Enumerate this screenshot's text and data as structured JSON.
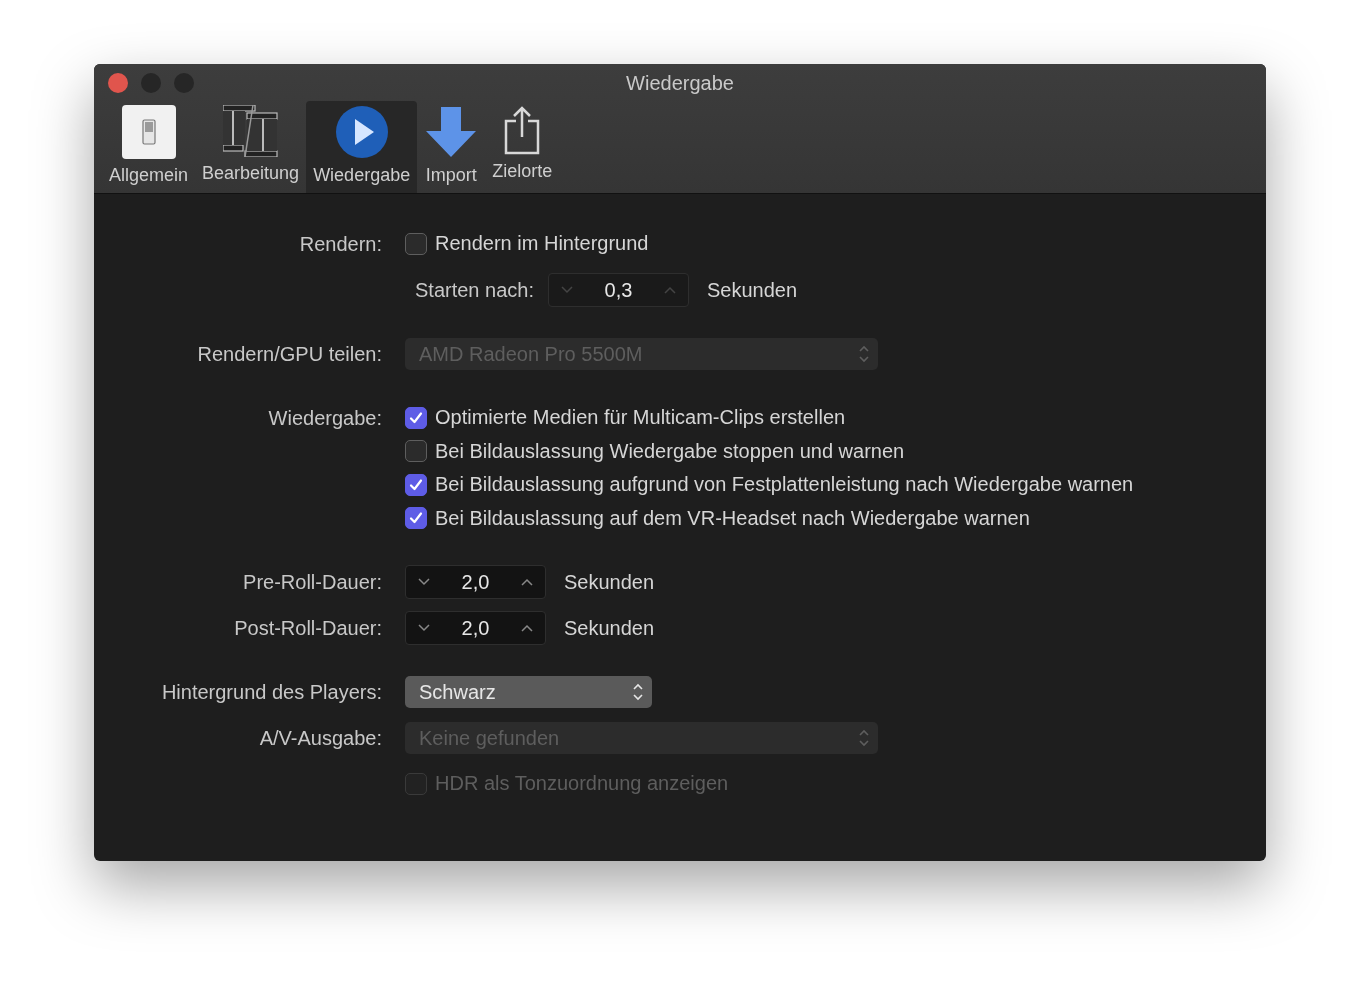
{
  "window": {
    "title": "Wiedergabe"
  },
  "toolbar": {
    "items": [
      {
        "label": "Allgemein",
        "kind": "switch",
        "selected": false
      },
      {
        "label": "Bearbeitung",
        "kind": "film",
        "selected": false
      },
      {
        "label": "Wiedergabe",
        "kind": "play",
        "selected": true
      },
      {
        "label": "Import",
        "kind": "download",
        "selected": false
      },
      {
        "label": "Zielorte",
        "kind": "share",
        "selected": false
      }
    ]
  },
  "sections": [
    {
      "rows": [
        {
          "label": "Rendern:",
          "kind": "checkboxes",
          "items": [
            {
              "label": "Rendern im Hintergrund",
              "checked": false,
              "disabled": false
            }
          ]
        },
        {
          "label": "Starten nach:",
          "kind": "inline_stepper",
          "value": "0,3",
          "unit": "Sekunden",
          "disabled": true
        }
      ]
    },
    {
      "rows": [
        {
          "label": "Rendern/GPU teilen:",
          "kind": "popup",
          "value": "AMD Radeon Pro 5500M",
          "disabled": true,
          "wide": true
        }
      ]
    },
    {
      "rows": [
        {
          "label": "Wiedergabe:",
          "kind": "checkboxes",
          "items": [
            {
              "label": "Optimierte Medien für Multicam-Clips erstellen",
              "checked": true,
              "disabled": false
            },
            {
              "label": "Bei Bildauslassung Wiedergabe stoppen und warnen",
              "checked": false,
              "disabled": false
            },
            {
              "label": "Bei Bildauslassung aufgrund von Festplattenleistung nach Wiedergabe warnen",
              "checked": true,
              "disabled": false
            },
            {
              "label": "Bei Bildauslassung auf dem VR-Headset nach Wiedergabe warnen",
              "checked": true,
              "disabled": false
            }
          ]
        }
      ]
    },
    {
      "rows": [
        {
          "label": "Pre-Roll-Dauer:",
          "kind": "stepper",
          "value": "2,0",
          "unit": "Sekunden",
          "disabled": false
        },
        {
          "label": "Post-Roll-Dauer:",
          "kind": "stepper",
          "value": "2,0",
          "unit": "Sekunden",
          "disabled": false
        }
      ]
    },
    {
      "rows": [
        {
          "label": "Hintergrund des Players:",
          "kind": "popup",
          "value": "Schwarz",
          "disabled": false,
          "wide": false
        },
        {
          "label": "A/V-Ausgabe:",
          "kind": "popup",
          "value": "Keine gefunden",
          "disabled": true,
          "wide": true
        },
        {
          "kind": "checkboxes",
          "items": [
            {
              "label": "HDR als Tonzuordnung anzeigen",
              "checked": false,
              "disabled": true
            }
          ]
        }
      ]
    }
  ]
}
